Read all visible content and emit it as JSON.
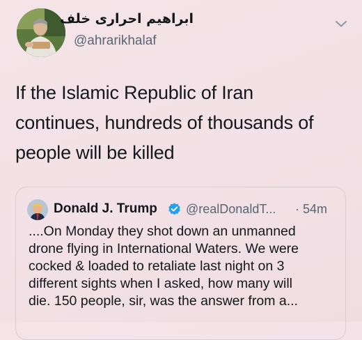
{
  "tweet": {
    "author": {
      "display_name": "ابراهیم احراری خلف",
      "handle": "@ahrarikhalaf",
      "avatar_icon": "profile-photo"
    },
    "menu_icon": "chevron-down-icon",
    "text_lines": [
      "If the Islamic Republic of Iran",
      "continues, hundreds of thousands of",
      "people will be killed"
    ]
  },
  "quoted_tweet": {
    "author": {
      "display_name": "Donald J. Trump",
      "handle": "@realDonaldT...",
      "verified": true,
      "avatar_icon": "profile-photo"
    },
    "separator": "·",
    "timestamp": "54m",
    "text_lines": [
      "....On Monday they shot down an unmanned",
      "drone flying in International Waters. We were",
      "cocked & loaded to retaliate last night on 3",
      "different sights when I asked, how many will",
      "die. 150 people, sir, was the answer from a..."
    ]
  },
  "colors": {
    "background": "#f3e3e7",
    "text_primary": "#14171a",
    "text_secondary": "#5b6570",
    "verified_blue": "#1da1f2",
    "card_border": "#d9cdd3"
  }
}
